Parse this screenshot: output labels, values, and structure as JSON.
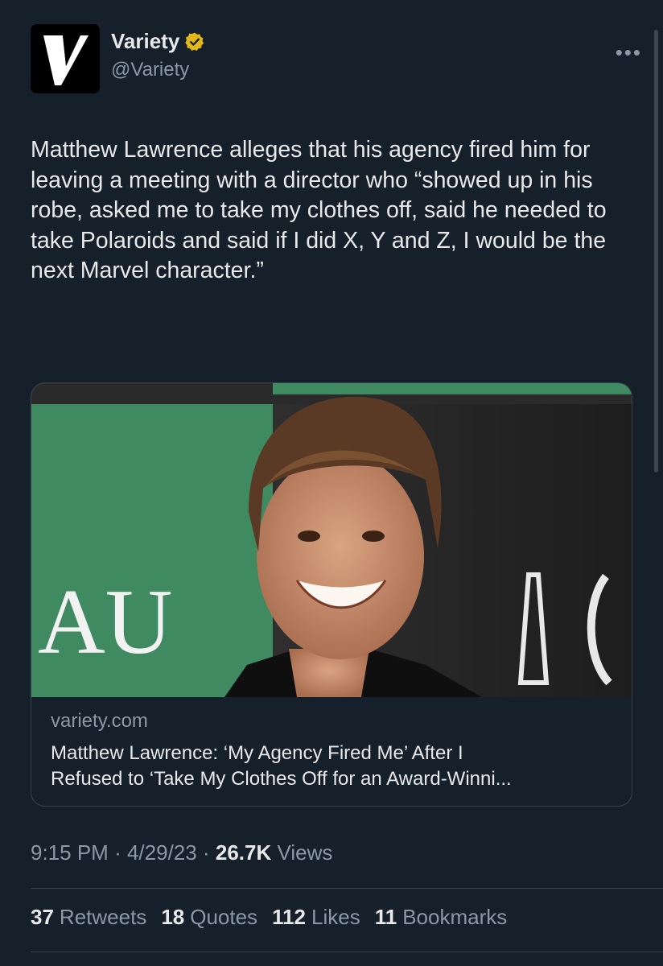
{
  "account": {
    "name": "Variety",
    "handle": "@Variety",
    "avatar_letter": "V",
    "verified_color": "#e2b719"
  },
  "menu": {
    "more_label": "•••"
  },
  "tweet": {
    "text": "Matthew Lawrence alleges that his agency fired him for leaving a meeting with a director who “showed up in his robe, asked me to take my clothes off, said he needed to take Polaroids and said if I did X, Y and Z, I would be the next Marvel character.”"
  },
  "card": {
    "image_signage_left": "AU",
    "domain": "variety.com",
    "title": "Matthew Lawrence: ‘My Agency Fired Me’ After I\nRefused to ‘Take My Clothes Off for an Award-Winni..."
  },
  "meta": {
    "time": "9:15 PM",
    "sep1": "·",
    "date": "4/29/23",
    "sep2": "·",
    "views_count": "26.7K",
    "views_label": "Views"
  },
  "stats": {
    "retweets_count": "37",
    "retweets_label": "Retweets",
    "quotes_count": "18",
    "quotes_label": "Quotes",
    "likes_count": "112",
    "likes_label": "Likes",
    "bookmarks_count": "11",
    "bookmarks_label": "Bookmarks"
  },
  "colors": {
    "background": "#15202b",
    "text": "#e7e9ea",
    "muted": "#8b98a5",
    "border": "#38444d"
  }
}
